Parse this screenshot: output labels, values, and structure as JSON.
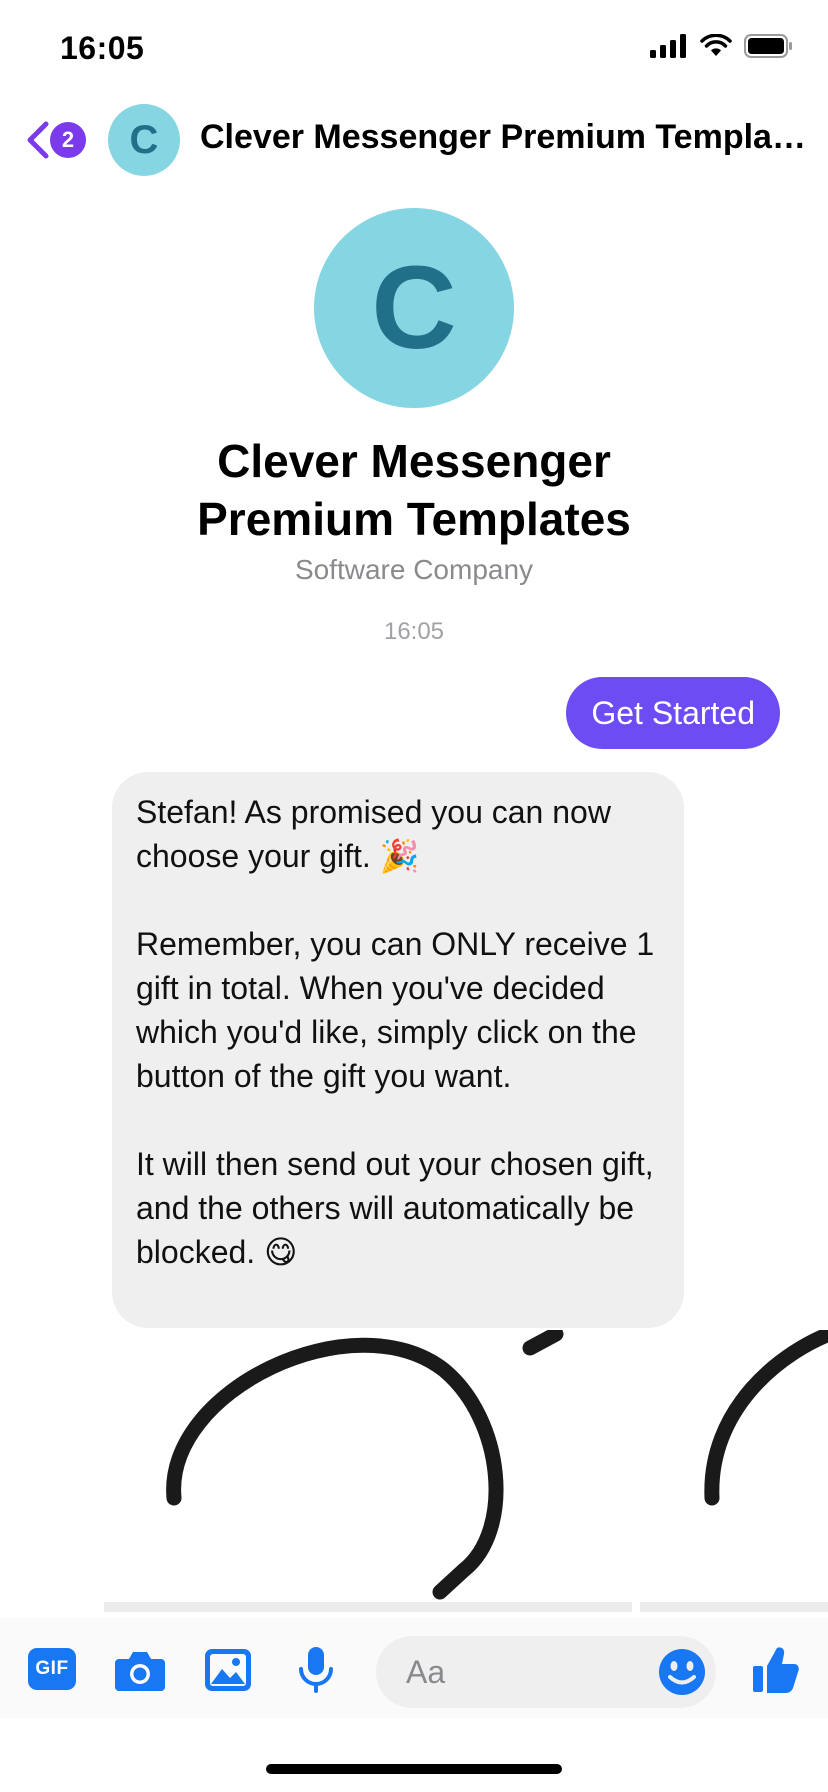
{
  "status_bar": {
    "time": "16:05"
  },
  "header": {
    "back_badge_count": "2",
    "avatar_letter": "C",
    "title": "Clever Messenger Premium Templates"
  },
  "profile": {
    "avatar_letter": "C",
    "name": "Clever Messenger Premium Templates",
    "category": "Software Company"
  },
  "conversation": {
    "timestamp": "16:05",
    "sent_message": "Get Started",
    "received_message": {
      "paragraph_1": "Stefan! As promised you can now choose your gift. 🎉",
      "paragraph_2": "Remember, you can ONLY receive 1 gift in total. When you've decided which you'd like, simply click on the button of the gift you want.",
      "paragraph_3": "It will then send out your chosen gift, and the others will automatically be blocked. 😋"
    }
  },
  "composer": {
    "gif_label": "GIF",
    "placeholder": "Aa"
  },
  "colors": {
    "accent_purple": "#6d4df3",
    "badge_purple": "#7c3aed",
    "messenger_blue": "#1877f2",
    "avatar_bg": "#86d5e2",
    "avatar_letter": "#21708a"
  },
  "icons": [
    "signal-icon",
    "wifi-icon",
    "battery-icon",
    "back-chevron-icon",
    "camera-icon",
    "image-icon",
    "microphone-icon",
    "emoji-icon",
    "thumbs-up-icon"
  ]
}
